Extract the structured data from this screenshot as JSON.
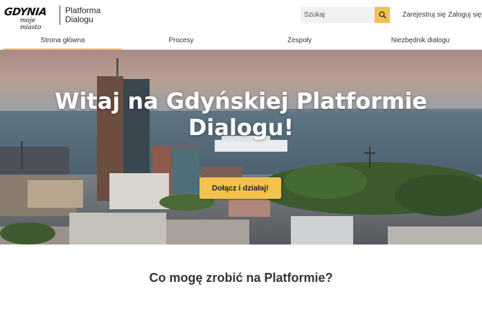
{
  "header": {
    "logo_text": "GDYNIA",
    "logo_tagline": "moje miasto",
    "platform_line1": "Platforma",
    "platform_line2": "Dialogu",
    "search_placeholder": "Szukaj",
    "search_icon": "search-icon",
    "register_label": "Zarejestruj się",
    "login_label": "Zaloguj się"
  },
  "nav": {
    "tabs": [
      {
        "label": "Strona główna",
        "active": true
      },
      {
        "label": "Procesy",
        "active": false
      },
      {
        "label": "Zespoły",
        "active": false
      },
      {
        "label": "Niezbędnik dialogu",
        "active": false
      }
    ]
  },
  "hero": {
    "title_line1": "Witaj na Gdyńskiej Platformie",
    "title_line2": "Dialogu!",
    "cta_label": "Dołącz i działaj!"
  },
  "main": {
    "section_title": "Co mogę zrobić na Platformie?"
  },
  "colors": {
    "accent": "#f2c14e",
    "text": "#222222"
  }
}
